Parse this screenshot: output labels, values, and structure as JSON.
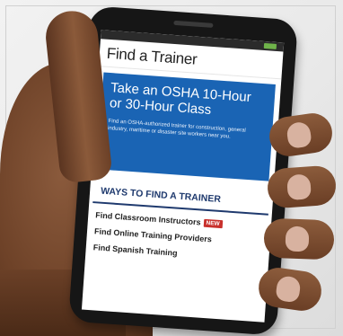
{
  "screen": {
    "title": "Find a Trainer",
    "hero": {
      "heading": "Take an OSHA 10-Hour or 30-Hour Class",
      "text": "Find an OSHA-authorized trainer for construction, general industry, maritime or disaster site workers near you."
    },
    "ways_heading": "WAYS TO FIND A TRAINER",
    "links": [
      {
        "label": "Find Classroom Instructors",
        "badge": "NEW"
      },
      {
        "label": "Find Online Training Providers"
      },
      {
        "label": "Find Spanish Training"
      }
    ]
  },
  "colors": {
    "hero_blue": "#1a64b4",
    "heading_navy": "#1f3a6e",
    "badge_red": "#c8302c"
  }
}
